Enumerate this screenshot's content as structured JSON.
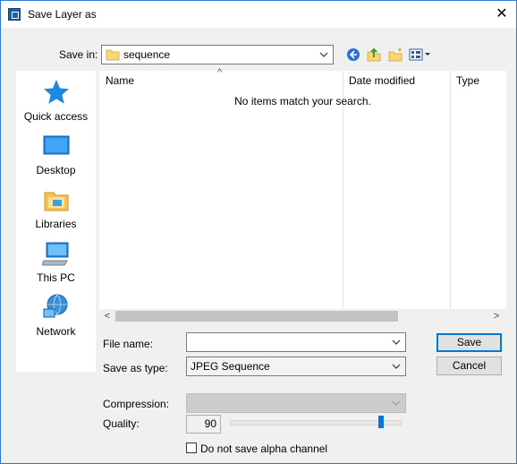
{
  "window": {
    "title": "Save Layer as",
    "close_glyph": "✕"
  },
  "save_in": {
    "label": "Save in:",
    "value": "sequence"
  },
  "toolbar": {
    "back_icon": "back-arrow-icon",
    "up_icon": "up-folder-icon",
    "new_folder_icon": "new-folder-icon",
    "view_menu_icon": "view-menu-icon"
  },
  "sidebar": {
    "items": [
      {
        "label": "Quick access",
        "icon": "star-icon"
      },
      {
        "label": "Desktop",
        "icon": "desktop-icon"
      },
      {
        "label": "Libraries",
        "icon": "libraries-icon"
      },
      {
        "label": "This PC",
        "icon": "computer-icon"
      },
      {
        "label": "Network",
        "icon": "network-icon"
      }
    ]
  },
  "file_list": {
    "sort_indicator": "^",
    "columns": [
      "Name",
      "Date modified",
      "Type"
    ],
    "empty_message": "No items match your search.",
    "scroll_left": "<",
    "scroll_right": ">"
  },
  "file_name": {
    "label": "File name:",
    "value": ""
  },
  "save_as_type": {
    "label": "Save as type:",
    "value": "JPEG Sequence"
  },
  "buttons": {
    "save": "Save",
    "cancel": "Cancel"
  },
  "compression": {
    "label": "Compression:",
    "value": ""
  },
  "quality": {
    "label": "Quality:",
    "value": "90",
    "slider_fraction": 0.9
  },
  "alpha": {
    "label": "Do not save alpha channel",
    "checked": false
  },
  "colors": {
    "accent": "#0078d7",
    "window_bg": "#f0f0f0"
  }
}
